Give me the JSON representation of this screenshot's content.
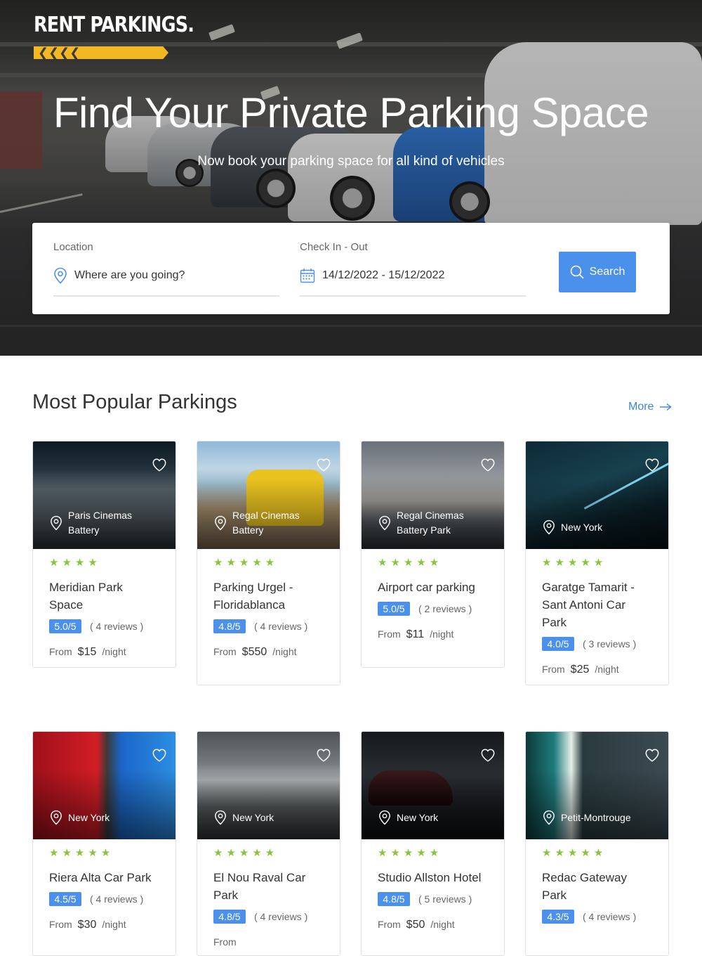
{
  "brand": {
    "name": "RENT PARKINGS.",
    "bar_glyphs": "❮❮❮❮",
    "accent_color": "#f2b824"
  },
  "hero": {
    "title": "Find Your Private Parking Space",
    "subtitle": "Now book your parking space for all kind of vehicles"
  },
  "search": {
    "location_label": "Location",
    "location_placeholder": "Where are you going?",
    "dates_label": "Check In - Out",
    "dates_value": "14/12/2022 - 15/12/2022",
    "button_label": "Search",
    "button_color": "#4b90ea"
  },
  "popular": {
    "title": "Most Popular Parkings",
    "more_label": "More"
  },
  "listings": [
    {
      "location": "Paris Cinemas Battery",
      "name": "Meridian Park Space",
      "rating": "5.0/5",
      "reviews": "( 4 reviews )",
      "from": "From",
      "price": "$15",
      "unit": "/night",
      "stars": "★★★★",
      "star_count": 4
    },
    {
      "location": "Regal Cinemas Battery",
      "name": "Parking Urgel - Floridablanca",
      "rating": "4.8/5",
      "reviews": "( 4 reviews )",
      "from": "From",
      "price": "$550",
      "unit": "/night",
      "stars": "★★★★★",
      "star_count": 5
    },
    {
      "location": "Regal Cinemas Battery Park",
      "name": "Airport car parking",
      "rating": "5.0/5",
      "reviews": "( 2 reviews )",
      "from": "From",
      "price": "$11",
      "unit": "/night",
      "stars": "★★★★★",
      "star_count": 5
    },
    {
      "location": "New York",
      "name": "Garatge Tamarit - Sant Antoni Car Park",
      "rating": "4.0/5",
      "reviews": "( 3 reviews )",
      "from": "From",
      "price": "$25",
      "unit": "/night",
      "stars": "★★★★★",
      "star_count": 5
    },
    {
      "location": "New York",
      "name": "Riera Alta Car Park",
      "rating": "4.5/5",
      "reviews": "( 4 reviews )",
      "from": "From",
      "price": "$30",
      "unit": "/night",
      "stars": "★★★★★",
      "star_count": 5
    },
    {
      "location": "New York",
      "name": "El Nou Raval Car Park",
      "rating": "4.8/5",
      "reviews": "( 4 reviews )",
      "from": "From",
      "price": "",
      "unit": "",
      "stars": "★★★★★",
      "star_count": 5
    },
    {
      "location": "New York",
      "name": "Studio Allston Hotel",
      "rating": "4.8/5",
      "reviews": "( 5 reviews )",
      "from": "From",
      "price": "$50",
      "unit": "/night",
      "stars": "★★★★★",
      "star_count": 5
    },
    {
      "location": "Petit-Montrouge",
      "name": "Redac Gateway Park",
      "rating": "4.3/5",
      "reviews": "( 4 reviews )",
      "from": "",
      "price": "",
      "unit": "",
      "stars": "★★★★★",
      "star_count": 5
    }
  ],
  "icons": {
    "location": "map-pin-icon",
    "calendar": "calendar-icon",
    "search": "search-icon",
    "favorite": "heart-icon",
    "arrow": "arrow-right-icon"
  },
  "colors": {
    "star": "#8ac43f",
    "badge": "#4b90ea",
    "link": "#3d86d8"
  }
}
